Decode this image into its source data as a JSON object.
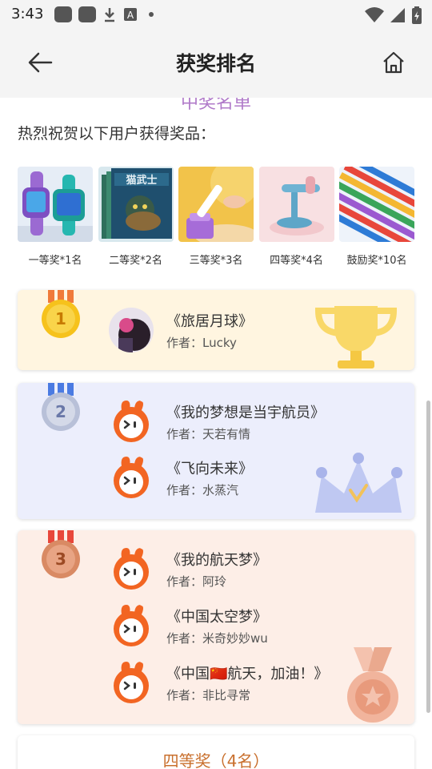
{
  "status": {
    "time": "3:43",
    "icons": [
      "notification-icon",
      "notification-icon",
      "download-icon",
      "font-icon",
      "dot-icon",
      "wifi-icon",
      "signal-icon",
      "battery-icon"
    ]
  },
  "header": {
    "title": "获奖排名",
    "back_icon": "back-arrow-icon",
    "home_icon": "home-icon"
  },
  "intro": {
    "cut_heading": "中奖名单",
    "text": "热烈祝贺以下用户获得奖品："
  },
  "prizes": [
    {
      "label": "一等奖*1名",
      "image": "smartwatch"
    },
    {
      "label": "二等奖*2名",
      "image": "book-set"
    },
    {
      "label": "三等奖*3名",
      "image": "reading-pen"
    },
    {
      "label": "四等奖*4名",
      "image": "desk-lamp"
    },
    {
      "label": "鼓励奖*10名",
      "image": "pencils"
    }
  ],
  "ranks": [
    {
      "medal": "1",
      "entries": [
        {
          "title": "《旅居月球》",
          "author": "作者：Lucky"
        }
      ]
    },
    {
      "medal": "2",
      "entries": [
        {
          "title": "《我的梦想是当宇航员》",
          "author": "作者：天若有情"
        },
        {
          "title": "《飞向未来》",
          "author": "作者：水蒸汽"
        }
      ]
    },
    {
      "medal": "3",
      "entries": [
        {
          "title": "《我的航天梦》",
          "author": "作者：阿玲"
        },
        {
          "title": "《中国太空梦》",
          "author": "作者：米奇妙妙wu"
        },
        {
          "title": "《中国🇨🇳航天，加油！》",
          "author": "作者：非比寻常"
        }
      ]
    }
  ],
  "fourth": {
    "title": "四等奖（4名）"
  },
  "colors": {
    "gold": "#f5b800",
    "silver": "#a9b2d8",
    "bronze": "#d98a64",
    "accent": "#c9702e",
    "avatar_orange": "#f26522"
  }
}
